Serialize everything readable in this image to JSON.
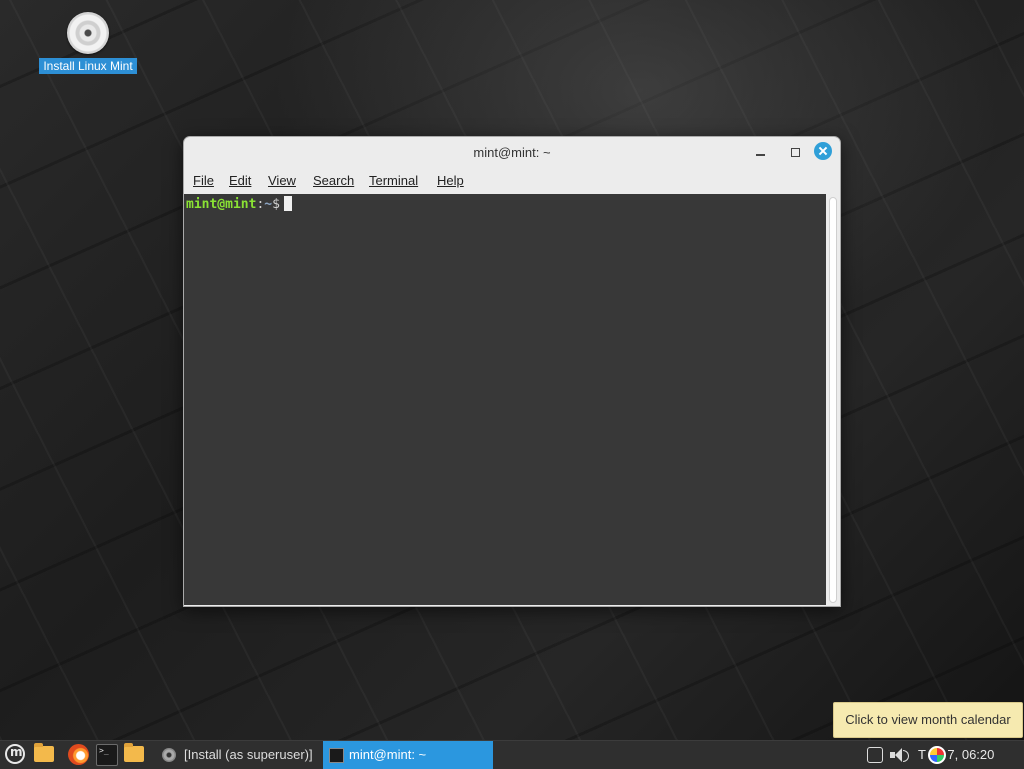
{
  "desktop": {
    "icons": [
      {
        "label": "Install Linux Mint",
        "icon": "disc-icon"
      }
    ]
  },
  "window": {
    "title": "mint@mint: ~",
    "menu": [
      {
        "label": "File"
      },
      {
        "label": "Edit"
      },
      {
        "label": "View"
      },
      {
        "label": "Search"
      },
      {
        "label": "Terminal"
      },
      {
        "label": "Help"
      }
    ],
    "prompt": {
      "user_host": "mint@mint",
      "separator": ":",
      "path": "~",
      "symbol": "$"
    }
  },
  "tooltip": {
    "text": "Click to view month calendar"
  },
  "taskbar": {
    "launchers": [
      "mint-menu-icon",
      "folder-icon",
      "firefox-icon",
      "terminal-icon",
      "files-icon"
    ],
    "tasks": [
      {
        "label": "[Install (as superuser)]",
        "active": false
      },
      {
        "label": "mint@mint: ~",
        "active": true
      }
    ],
    "clock": "T  an  7, 06:20"
  },
  "colors": {
    "accent": "#2b97df",
    "prompt_green": "#8ae234",
    "terminal_bg": "#383838",
    "tooltip_bg": "#f6eab0"
  }
}
